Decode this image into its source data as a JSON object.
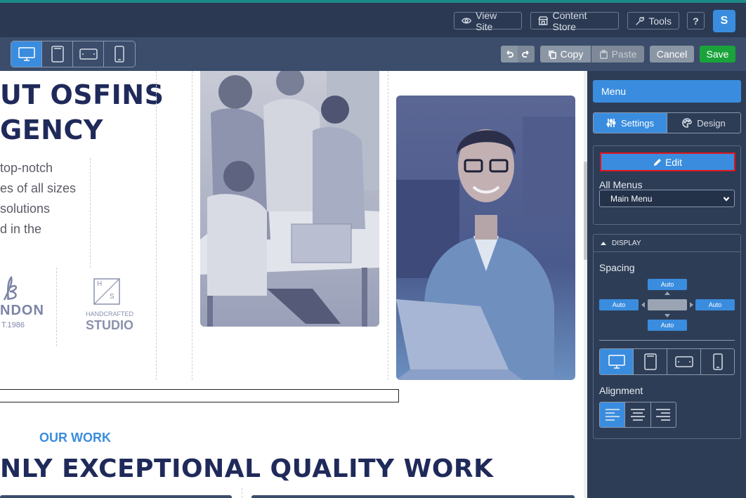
{
  "topbar": {
    "view_site": "View Site",
    "content_store": "Content Store",
    "tools": "Tools",
    "help": "?",
    "avatar": "S"
  },
  "toolbar": {
    "devices": [
      "desktop-icon",
      "tablet-icon",
      "tablet-landscape-icon",
      "mobile-icon"
    ],
    "active_device": "desktop",
    "copy": "Copy",
    "paste": "Paste",
    "cancel": "Cancel",
    "save": "Save"
  },
  "canvas": {
    "headline_1": "UT OSFINS",
    "headline_2": "GENCY",
    "body_lines": [
      "top-notch",
      "es of all sizes",
      "solutions",
      "d in the"
    ],
    "logo_1_text": "NDON",
    "logo_1_sub": "T.1986",
    "logo_2_top": "H",
    "logo_2_mid": "S",
    "logo_2_text_1": "HANDCRAFTED",
    "logo_2_text_2": "STUDIO",
    "section_label": "OUR WORK",
    "section_title": "NLY EXCEPTIONAL QUALITY WORK"
  },
  "panel": {
    "title": "Menu",
    "tab_settings": "Settings",
    "tab_design": "Design",
    "edit_label": "Edit",
    "all_menus_label": "All Menus",
    "menu_select_value": "Main Menu",
    "display_header": "DISPLAY",
    "spacing_label": "Spacing",
    "spacing": {
      "top": "Auto",
      "left": "Auto",
      "right": "Auto",
      "bottom": "Auto"
    },
    "alignment_label": "Alignment",
    "alignment_active": "left"
  },
  "colors": {
    "accent": "#3a8dde",
    "save": "#1aa33a",
    "topbar": "#2b3a52",
    "panel": "#2e3d56",
    "headline": "#1f2a5a",
    "edit_outline": "#e0141c"
  }
}
